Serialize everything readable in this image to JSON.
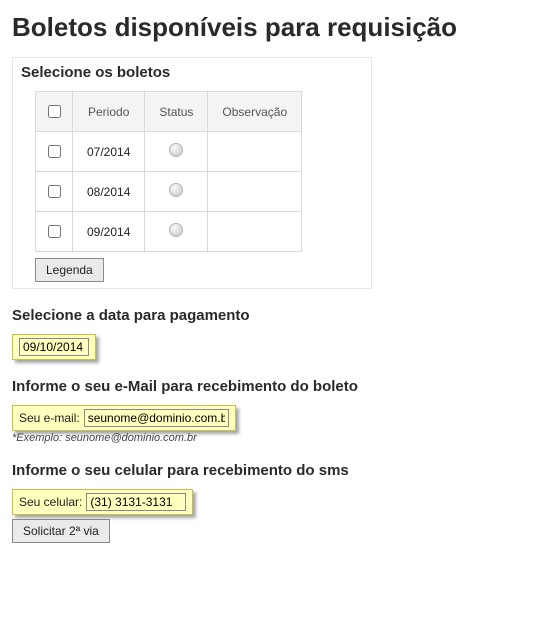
{
  "page_title": "Boletos disponíveis para requisição",
  "section_select": {
    "title": "Selecione os boletos",
    "columns": {
      "periodo": "Periodo",
      "status": "Status",
      "observacao": "Observação"
    },
    "rows": [
      {
        "periodo": "07/2014",
        "observacao": ""
      },
      {
        "periodo": "08/2014",
        "observacao": ""
      },
      {
        "periodo": "09/2014",
        "observacao": ""
      }
    ],
    "legend_button": "Legenda"
  },
  "section_date": {
    "title": "Selecione a data para pagamento",
    "value": "09/10/2014"
  },
  "section_email": {
    "title": "Informe o seu e-Mail para recebimento do boleto",
    "label": "Seu e-mail:",
    "value": "seunome@dominio.com.br",
    "example": "*Exemplo: seunome@dominio.com.br"
  },
  "section_cell": {
    "title": "Informe o seu celular para recebimento do sms",
    "label": "Seu celular:",
    "value": "(31) 3131-3131"
  },
  "submit_button": "Solicitar 2ª via"
}
